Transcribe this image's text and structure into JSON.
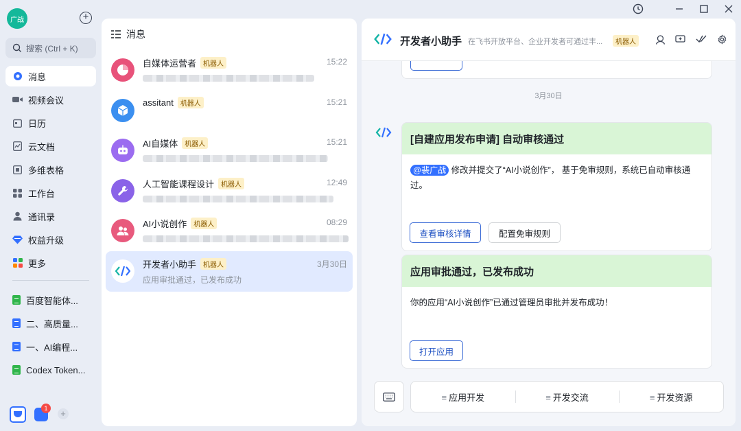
{
  "app": {
    "user_avatar_text": "广战",
    "search_placeholder": "搜索 (Ctrl + K)",
    "nav": [
      {
        "label": "消息",
        "icon": "message-icon",
        "color": "#3370ff"
      },
      {
        "label": "视频会议",
        "icon": "video-icon",
        "color": "#5d6473"
      },
      {
        "label": "日历",
        "icon": "calendar-icon",
        "color": "#5d6473"
      },
      {
        "label": "云文档",
        "icon": "cloud-doc-icon",
        "color": "#5d6473"
      },
      {
        "label": "多维表格",
        "icon": "base-table-icon",
        "color": "#5d6473"
      },
      {
        "label": "工作台",
        "icon": "workspace-icon",
        "color": "#5d6473"
      },
      {
        "label": "通讯录",
        "icon": "contacts-icon",
        "color": "#5d6473"
      },
      {
        "label": "权益升级",
        "icon": "diamond-icon",
        "color": "#3370ff"
      },
      {
        "label": "更多",
        "icon": "more-apps-icon",
        "color": "#3370ff"
      }
    ],
    "shortcuts": [
      {
        "label": "百度智能体...",
        "color": "#2fb54a"
      },
      {
        "label": "二、高质量...",
        "color": "#3370ff"
      },
      {
        "label": "一、AI编程...",
        "color": "#3370ff"
      },
      {
        "label": "Codex Token...",
        "color": "#2fb54a"
      }
    ],
    "bottom_badge": "1"
  },
  "chatlist": {
    "title": "消息",
    "robot_tag": "机器人",
    "items": [
      {
        "name": "自媒体运营者",
        "time": "15:22",
        "avatar_color": "#e8527a",
        "icon": "pie-chart-icon",
        "preview": "",
        "blur_width": 250
      },
      {
        "name": "assitant",
        "time": "15:21",
        "avatar_color": "#3b8ff0",
        "icon": "cube-icon",
        "preview": "",
        "blur_width": 0
      },
      {
        "name": "AI自媒体",
        "time": "15:21",
        "avatar_color": "#9b6cf0",
        "icon": "robot-icon",
        "preview": "",
        "blur_width": 270
      },
      {
        "name": "人工智能课程设计",
        "time": "12:49",
        "avatar_color": "#8a63e8",
        "icon": "wrench-icon",
        "preview": "",
        "blur_width": 278
      },
      {
        "name": "AI小说创作",
        "time": "08:29",
        "avatar_color": "#e85a7d",
        "icon": "group-icon",
        "preview": "",
        "blur_width": 300
      },
      {
        "name": "开发者小助手",
        "time": "3月30日",
        "avatar_color": "#ffffff",
        "icon": "dev-helper-icon",
        "preview": "应用审批通过，已发布成功",
        "blur_width": 0
      }
    ]
  },
  "chat": {
    "title": "开发者小助手",
    "description": "在飞书开放平台、企业开发者可通过丰...",
    "robot_tag": "机器人",
    "date_separator": "3月30日",
    "card1": {
      "header": "[自建应用发布申请] 自动审核通过",
      "mention": "@裴广战",
      "body": "修改并提交了“AI小说创作”， 基于免审规则，系统已自动审核通过。",
      "primary_button": "查看审核详情",
      "secondary_button": "配置免审规则"
    },
    "card2": {
      "header": "应用审批通过，已发布成功",
      "body": "你的应用“AI小说创作”已通过管理员审批并发布成功！",
      "primary_button": "打开应用"
    },
    "quick_actions": [
      {
        "prefix": "≡",
        "label": "应用开发"
      },
      {
        "prefix": "≡",
        "label": "开发交流"
      },
      {
        "prefix": "≡",
        "label": "开发资源"
      }
    ]
  },
  "colors": {
    "accent": "#3370ff",
    "card_header_green": "#d9f5d6",
    "robot_tag_bg": "#fdf0c8"
  }
}
